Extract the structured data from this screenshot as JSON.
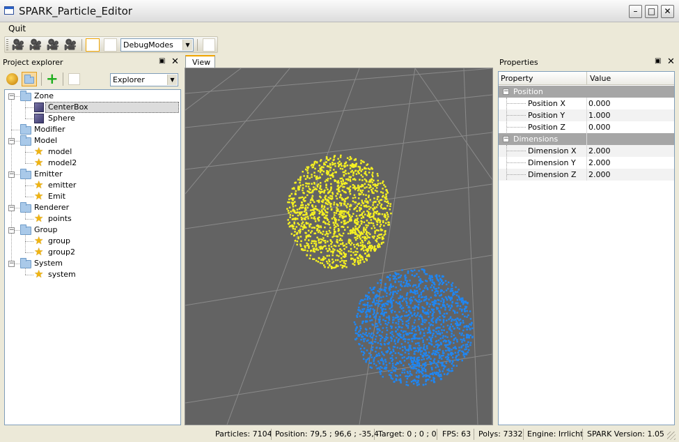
{
  "window": {
    "title": "SPARK_Particle_Editor",
    "min": "–",
    "max": "□",
    "close": "✕"
  },
  "menu": {
    "quit": "Quit"
  },
  "toolbar": {
    "debug_modes": "DebugModes",
    "camera_icon": "🎥"
  },
  "explorer": {
    "title": "Project explorer",
    "mode": "Explorer",
    "items": [
      {
        "label": "Zone",
        "type": "folder"
      },
      {
        "label": "CenterBox",
        "type": "cube"
      },
      {
        "label": "Sphere",
        "type": "cube"
      },
      {
        "label": "Modifier",
        "type": "folder"
      },
      {
        "label": "Model",
        "type": "folder"
      },
      {
        "label": "model",
        "type": "star"
      },
      {
        "label": "model2",
        "type": "star"
      },
      {
        "label": "Emitter",
        "type": "folder"
      },
      {
        "label": "emitter",
        "type": "star"
      },
      {
        "label": "Emit",
        "type": "star"
      },
      {
        "label": "Renderer",
        "type": "folder"
      },
      {
        "label": "points",
        "type": "star"
      },
      {
        "label": "Group",
        "type": "folder"
      },
      {
        "label": "group",
        "type": "star"
      },
      {
        "label": "group2",
        "type": "star"
      },
      {
        "label": "System",
        "type": "folder"
      },
      {
        "label": "system",
        "type": "star"
      }
    ]
  },
  "view": {
    "tab": "View",
    "colors": {
      "yellow": "#f5f022",
      "blue": "#1f86f2",
      "grid_bg": "#636363"
    }
  },
  "properties": {
    "title": "Properties",
    "col_property": "Property",
    "col_value": "Value",
    "group_position": "Position",
    "pos_x_label": "Position X",
    "pos_x": "0.000",
    "pos_y_label": "Position Y",
    "pos_y": "1.000",
    "pos_z_label": "Position Z",
    "pos_z": "0.000",
    "group_dimensions": "Dimensions",
    "dim_x_label": "Dimension X",
    "dim_x": "2.000",
    "dim_y_label": "Dimension Y",
    "dim_y": "2.000",
    "dim_z_label": "Dimension Z",
    "dim_z": "2.000"
  },
  "status": {
    "particles": "Particles: 7104",
    "position": "Position: 79,5 ; 96,6 ; -35,4",
    "target": "Target: 0 ; 0 ; 0",
    "fps": "FPS: 63",
    "polys": "Polys: 7332",
    "engine": "Engine: Irrlicht",
    "version": "SPARK Version: 1.05"
  }
}
